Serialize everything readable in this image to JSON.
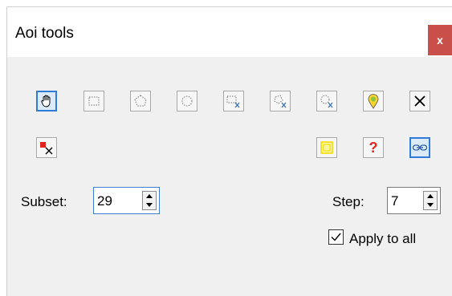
{
  "window": {
    "title": "Aoi tools",
    "close_label": "x"
  },
  "toolbar": {
    "row1": [
      {
        "name": "pan-tool-icon",
        "active": true
      },
      {
        "name": "rectangle-select-icon",
        "active": false
      },
      {
        "name": "polygon-select-icon",
        "active": false
      },
      {
        "name": "circle-select-icon",
        "active": false
      },
      {
        "name": "rectangle-cut-icon",
        "active": false
      },
      {
        "name": "polygon-cut-icon",
        "active": false
      },
      {
        "name": "circle-cut-icon",
        "active": false
      },
      {
        "name": "location-pin-icon",
        "active": false
      },
      {
        "name": "delete-icon",
        "active": false
      }
    ],
    "row2_left": [
      {
        "name": "clear-markers-icon",
        "active": false
      }
    ],
    "row2_right": [
      {
        "name": "yellow-square-icon",
        "active": false
      },
      {
        "name": "help-question-icon",
        "active": false
      },
      {
        "name": "link-icon",
        "active": true
      }
    ]
  },
  "fields": {
    "subset_label": "Subset:",
    "subset_value": "29",
    "step_label": "Step:",
    "step_value": "7",
    "apply_label": "Apply to all",
    "apply_checked": true
  },
  "colors": {
    "close_bg": "#c9504a",
    "active_border": "#2f7bd6",
    "pin_green": "#8bc63f",
    "pin_yellow": "#f6d32d",
    "help_red": "#e0261e"
  }
}
